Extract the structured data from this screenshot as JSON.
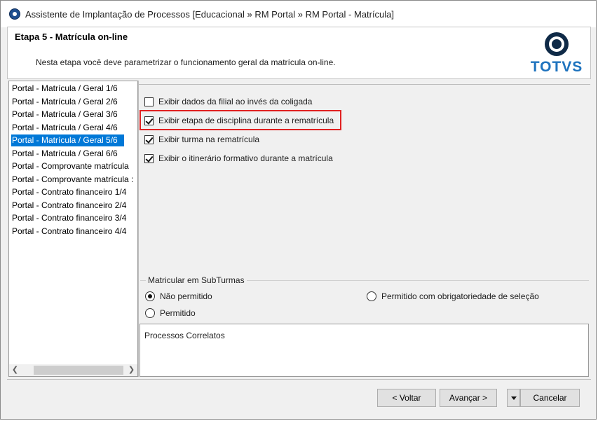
{
  "window": {
    "title": "Assistente de Implantação de Processos [Educacional » RM Portal » RM Portal - Matrícula]"
  },
  "header": {
    "step_title": "Etapa 5 - Matrícula on-line",
    "description": "Nesta etapa você deve parametrizar o funcionamento geral da matrícula on-line.",
    "logo_text": "TOTVS"
  },
  "steps": {
    "items": [
      {
        "label": "Portal - Matrícula / Geral 1/6",
        "selected": false
      },
      {
        "label": "Portal - Matrícula / Geral 2/6",
        "selected": false
      },
      {
        "label": "Portal - Matrícula / Geral 3/6",
        "selected": false
      },
      {
        "label": "Portal - Matrícula / Geral 4/6",
        "selected": false
      },
      {
        "label": "Portal - Matrícula / Geral 5/6",
        "selected": true
      },
      {
        "label": "Portal - Matrícula / Geral 6/6",
        "selected": false
      },
      {
        "label": "Portal - Comprovante matrícula",
        "selected": false
      },
      {
        "label": "Portal - Comprovante matrícula :",
        "selected": false
      },
      {
        "label": "Portal - Contrato financeiro 1/4",
        "selected": false
      },
      {
        "label": "Portal - Contrato financeiro 2/4",
        "selected": false
      },
      {
        "label": "Portal - Contrato financeiro 3/4",
        "selected": false
      },
      {
        "label": "Portal - Contrato financeiro 4/4",
        "selected": false
      }
    ],
    "scroll_left_icon": "chevron-left-icon",
    "scroll_right_icon": "chevron-right-icon"
  },
  "options": [
    {
      "label": "Exibir dados da filial ao invés da coligada",
      "checked": false
    },
    {
      "label": "Exibir etapa de disciplina durante a rematrícula",
      "checked": true,
      "highlighted": true
    },
    {
      "label": "Exibir turma na rematrícula",
      "checked": true
    },
    {
      "label": "Exibir o itinerário formativo durante a matrícula",
      "checked": true
    }
  ],
  "subturmas": {
    "title": "Matricular em SubTurmas",
    "options": [
      {
        "label": "Não permitido",
        "selected": true
      },
      {
        "label": "Permitido com obrigatoriedade de seleção",
        "selected": false
      },
      {
        "label": "Permitido",
        "selected": false
      }
    ]
  },
  "related": {
    "title": "Processos Correlatos"
  },
  "footer": {
    "back_label": "< Voltar",
    "next_label": "Avançar >",
    "cancel_label": "Cancelar"
  },
  "colors": {
    "selection": "#0078d7",
    "highlight_border": "#e02020",
    "logo_blue": "#1e73be",
    "logo_dark": "#0f2a47"
  }
}
